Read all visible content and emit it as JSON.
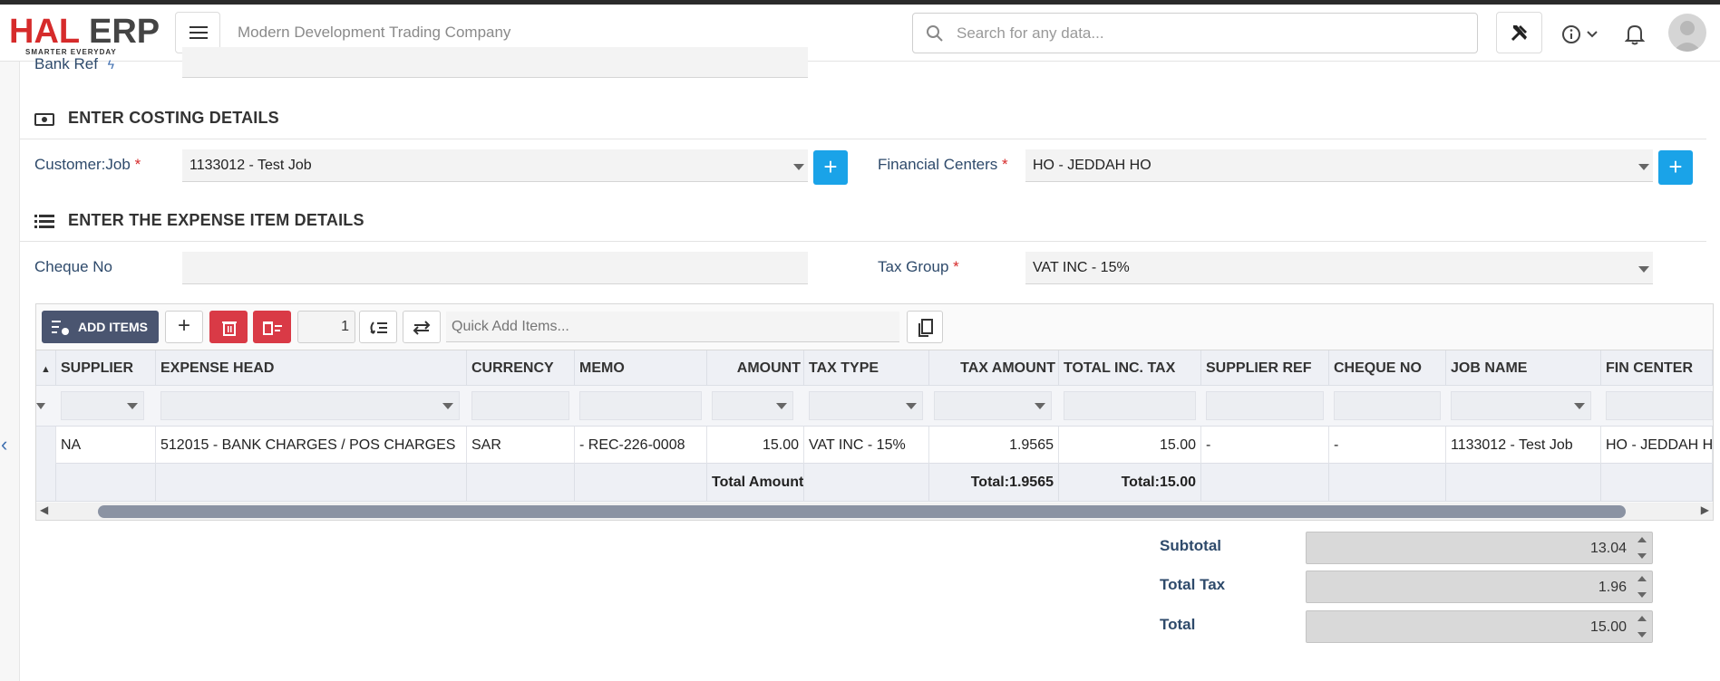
{
  "header": {
    "logo_hal": "HAL",
    "logo_erp": "ERP",
    "logo_tagline": "SMARTER EVERYDAY",
    "company": "Modern Development Trading Company",
    "search_placeholder": "Search for any data..."
  },
  "bank_ref": {
    "label": "Bank Ref"
  },
  "costing": {
    "title": "ENTER COSTING DETAILS",
    "customer_job_label": "Customer:Job",
    "customer_job_value": "1133012 - Test Job",
    "financial_centers_label": "Financial Centers",
    "financial_centers_value": "HO - JEDDAH HO",
    "add_label": "+"
  },
  "expense": {
    "title": "ENTER THE EXPENSE ITEM DETAILS",
    "cheque_no_label": "Cheque No",
    "cheque_no_value": "",
    "tax_group_label": "Tax Group",
    "tax_group_value": "VAT INC - 15%"
  },
  "grid": {
    "add_items_label": "ADD ITEMS",
    "qty_value": "1",
    "quick_add_placeholder": "Quick Add Items...",
    "columns": [
      "SUPPLIER",
      "EXPENSE HEAD",
      "CURRENCY",
      "MEMO",
      "AMOUNT",
      "TAX TYPE",
      "TAX AMOUNT",
      "TOTAL INC. TAX",
      "SUPPLIER REF",
      "CHEQUE NO",
      "JOB NAME",
      "FIN CENTER"
    ],
    "row": {
      "supplier": "NA",
      "expense_head": "512015 - BANK CHARGES / POS CHARGES",
      "currency": "SAR",
      "memo": "- REC-226-0008",
      "amount": "15.00",
      "tax_type": "VAT INC - 15%",
      "tax_amount": "1.9565",
      "total_inc_tax": "15.00",
      "supplier_ref": "-",
      "cheque_no": "-",
      "job_name": "1133012 - Test Job",
      "fin_center": "HO - JEDDAH HO"
    },
    "summary": {
      "amount": "Total Amount",
      "tax_amount": "Total:1.9565",
      "total_inc_tax": "Total:15.00"
    }
  },
  "totals": {
    "subtotal_label": "Subtotal",
    "subtotal_value": "13.04",
    "total_tax_label": "Total Tax",
    "total_tax_value": "1.96",
    "total_label": "Total",
    "total_value": "15.00"
  },
  "colors": {
    "brand_red": "#d62b2b",
    "accent_blue": "#1aa3e8",
    "delete_red": "#d93a46",
    "add_items_bg": "#4a5570"
  }
}
